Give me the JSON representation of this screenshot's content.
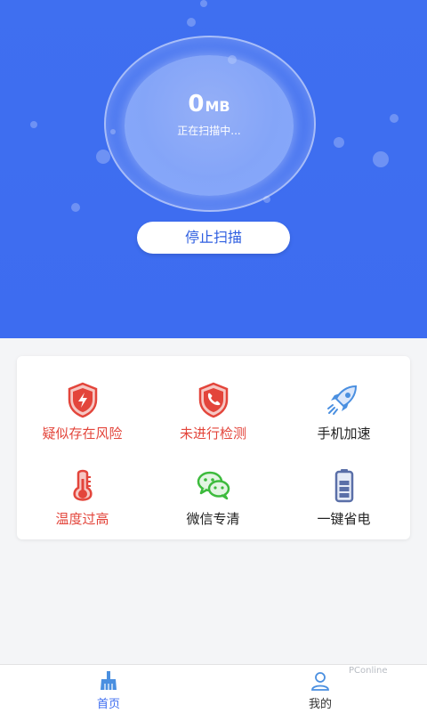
{
  "scan": {
    "size_value": "0",
    "size_unit": "MB",
    "status": "正在扫描中...",
    "stop_label": "停止扫描"
  },
  "features": [
    {
      "label": "疑似存在风险",
      "icon": "shield-bolt-icon",
      "color": "#e3453b"
    },
    {
      "label": "未进行检测",
      "icon": "shield-phone-icon",
      "color": "#e3453b"
    },
    {
      "label": "手机加速",
      "icon": "rocket-icon",
      "color": "#222222"
    },
    {
      "label": "温度过高",
      "icon": "thermometer-icon",
      "color": "#e3453b"
    },
    {
      "label": "微信专清",
      "icon": "wechat-icon",
      "color": "#222222"
    },
    {
      "label": "一键省电",
      "icon": "battery-icon",
      "color": "#222222"
    }
  ],
  "tabs": [
    {
      "label": "首页",
      "icon": "broom-icon",
      "active": true
    },
    {
      "label": "我的",
      "icon": "user-icon",
      "active": false
    }
  ],
  "colors": {
    "primary": "#3d6cf0",
    "danger": "#e3453b",
    "wechat": "#3dbb3d"
  },
  "watermark": "PConline"
}
